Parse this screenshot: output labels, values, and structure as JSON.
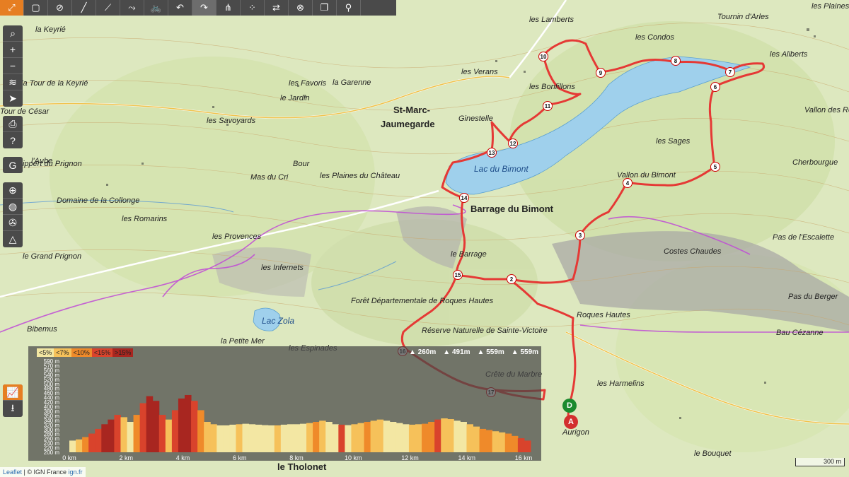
{
  "toolbar": {
    "active_tool": "fullscreen-icon",
    "selected_tool": "redo-icon",
    "icons": [
      "fullscreen-icon",
      "select-icon",
      "eye-off-icon",
      "draw-line-icon",
      "draw-polyline-icon",
      "route-icon",
      "bike-icon",
      "undo-icon",
      "redo-icon",
      "branch-icon",
      "nodes-icon",
      "swap-icon",
      "no-route-icon",
      "copy-icon",
      "marker-icon"
    ]
  },
  "sidebar": {
    "group1": [
      "search-icon",
      "zoom-in-icon",
      "zoom-out-icon",
      "layers-icon",
      "locate-icon"
    ],
    "group2": [
      "print-icon",
      "help-icon"
    ],
    "group3": [
      "google-icon"
    ],
    "group4": [
      "crosshair-icon",
      "globe-icon",
      "compass-icon",
      "terrain-icon"
    ],
    "group5": [
      "chart-icon",
      "download-icon"
    ]
  },
  "map": {
    "labels": [
      {
        "text": "la Keyrié",
        "cls": "place"
      },
      {
        "text": "la Tour de la Keyrié",
        "cls": "place"
      },
      {
        "text": "la Garenne",
        "cls": "place"
      },
      {
        "text": "les Favoris",
        "cls": "place"
      },
      {
        "text": "le Jardin",
        "cls": "place"
      },
      {
        "text": "les Savoyards",
        "cls": "place"
      },
      {
        "text": "St-Marc-",
        "cls": "big"
      },
      {
        "text": "Jaumegarde",
        "cls": "big"
      },
      {
        "text": "Lac du Bimont",
        "cls": "lake"
      },
      {
        "text": "Barrage du Bimont",
        "cls": "big"
      },
      {
        "text": "les Plaines du Château",
        "cls": "place"
      },
      {
        "text": "le Barrage",
        "cls": "place"
      },
      {
        "text": "les Infernets",
        "cls": "place"
      },
      {
        "text": "Forêt Départementale de Roques Hautes",
        "cls": "place"
      },
      {
        "text": "Réserve Naturelle de Sainte-Victoire",
        "cls": "place"
      },
      {
        "text": "Roques Hautes",
        "cls": "place"
      },
      {
        "text": "Costes Chaudes",
        "cls": "place"
      },
      {
        "text": "Vallon du Bimont",
        "cls": "place"
      },
      {
        "text": "les Sages",
        "cls": "place"
      },
      {
        "text": "Tournin d'Arles",
        "cls": "place"
      },
      {
        "text": "les Aliberts",
        "cls": "place"
      },
      {
        "text": "les Condos",
        "cls": "place"
      },
      {
        "text": "les Plaines",
        "cls": "place"
      },
      {
        "text": "Cherbourgue",
        "cls": "place"
      },
      {
        "text": "Vallon des Reynauds",
        "cls": "place"
      },
      {
        "text": "Pas de l'Escalette",
        "cls": "place"
      },
      {
        "text": "Pas du Berger",
        "cls": "place"
      },
      {
        "text": "Bau Cézanne",
        "cls": "place"
      },
      {
        "text": "les Harmelins",
        "cls": "place"
      },
      {
        "text": "le Bouquet",
        "cls": "place"
      },
      {
        "text": "le Grand Prignon",
        "cls": "place"
      },
      {
        "text": "Bibemus",
        "cls": "place"
      },
      {
        "text": "la Petite Mer",
        "cls": "place"
      },
      {
        "text": "les Espinades",
        "cls": "place"
      },
      {
        "text": "Lac Zola",
        "cls": "lake"
      },
      {
        "text": "le Tholonet",
        "cls": "big"
      },
      {
        "text": "l'Aube",
        "cls": "place"
      },
      {
        "text": "Rippert du Prignon",
        "cls": "place"
      },
      {
        "text": "Domaine de la Collonge",
        "cls": "place"
      },
      {
        "text": "les Romarins",
        "cls": "place"
      },
      {
        "text": "les Provences",
        "cls": "place"
      },
      {
        "text": "Mas du Cri",
        "cls": "place"
      },
      {
        "text": "Bour",
        "cls": "place"
      },
      {
        "text": "Tour de César",
        "cls": "place"
      },
      {
        "text": "les Verans",
        "cls": "place"
      },
      {
        "text": "les Bonfillons",
        "cls": "place"
      },
      {
        "text": "Ginestelle",
        "cls": "place"
      },
      {
        "text": "les Lamberts",
        "cls": "place"
      },
      {
        "text": "Aurigon",
        "cls": "place"
      },
      {
        "text": "Crête du Marbre",
        "cls": "place"
      }
    ],
    "waypoints": [
      "2",
      "3",
      "4",
      "5",
      "6",
      "7",
      "8",
      "9",
      "10",
      "11",
      "12",
      "13",
      "14",
      "15",
      "16",
      "17"
    ],
    "start_label": "D",
    "end_label": "A",
    "route_color": "#e53935",
    "start_color": "#1b8a2e",
    "end_color": "#d32f2f"
  },
  "profile": {
    "grade_legend": [
      "<5%",
      "<7%",
      "<10%",
      "<15%",
      ">15%"
    ],
    "grade_colors": [
      "#f3e7a3",
      "#f6c15a",
      "#ef8a2a",
      "#d9432c",
      "#a82620"
    ],
    "stats": [
      "260m",
      "491m",
      "559m",
      "559m"
    ],
    "y_ticks": [
      "590 m",
      "570 m",
      "560 m",
      "540 m",
      "520 m",
      "500 m",
      "480 m",
      "460 m",
      "440 m",
      "420 m",
      "400 m",
      "380 m",
      "350 m",
      "340 m",
      "320 m",
      "300 m",
      "280 m",
      "260 m",
      "240 m",
      "220 m",
      "200 m"
    ],
    "x_ticks": [
      "0 km",
      "2 km",
      "4 km",
      "6 km",
      "8 km",
      "10 km",
      "12 km",
      "14 km",
      "16 km"
    ]
  },
  "attribution": {
    "leaflet": "Leaflet",
    "sep": "| © IGN France",
    "ign": "ign.fr"
  },
  "scale": "300 m"
}
